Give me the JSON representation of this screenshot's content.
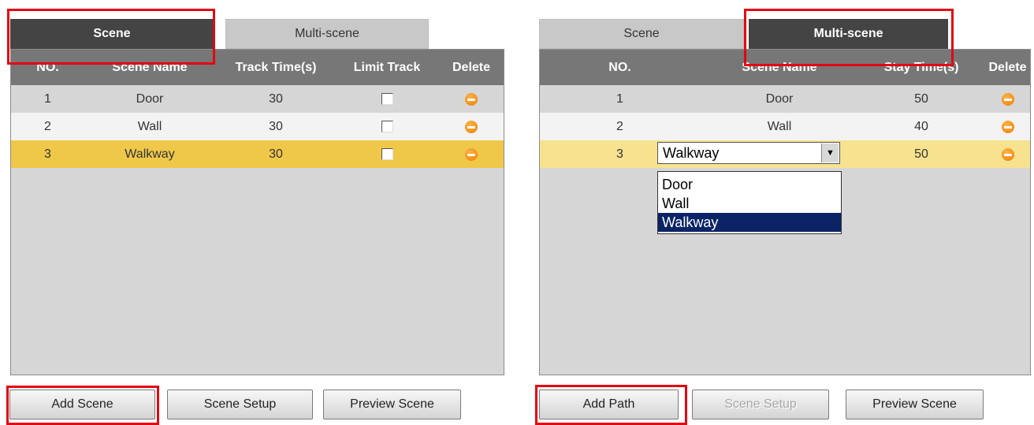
{
  "left": {
    "tabs": [
      {
        "label": "Scene",
        "active": true
      },
      {
        "label": "Multi-scene",
        "active": false
      }
    ],
    "columns": [
      "NO.",
      "Scene Name",
      "Track Time(s)",
      "Limit Track",
      "Delete"
    ],
    "rows": [
      {
        "no": "1",
        "name": "Door",
        "time": "30",
        "limit_checked": false
      },
      {
        "no": "2",
        "name": "Wall",
        "time": "30",
        "limit_checked": false
      },
      {
        "no": "3",
        "name": "Walkway",
        "time": "30",
        "limit_checked": false
      }
    ],
    "buttons": {
      "add": "Add Scene",
      "setup": "Scene Setup",
      "preview": "Preview Scene"
    }
  },
  "right": {
    "tabs": [
      {
        "label": "Scene",
        "active": false
      },
      {
        "label": "Multi-scene",
        "active": true
      }
    ],
    "columns": [
      "NO.",
      "Scene Name",
      "Stay Time(s)",
      "Delete"
    ],
    "rows": [
      {
        "no": "1",
        "name": "Door",
        "time": "50"
      },
      {
        "no": "2",
        "name": "Wall",
        "time": "40"
      },
      {
        "no": "3",
        "name": "Walkway",
        "time": "50"
      }
    ],
    "combo": {
      "value": "Walkway",
      "options": [
        "Door",
        "Wall",
        "Walkway"
      ]
    },
    "buttons": {
      "add": "Add Path",
      "setup": "Scene Setup",
      "preview": "Preview Scene"
    }
  },
  "colors": {
    "highlight": "#e30613",
    "active_tab": "#444444",
    "header": "#777777",
    "selected_row_left": "#efc84a",
    "selected_row_right": "#f7e28f",
    "dropdown_selected": "#0b2466",
    "delete_icon": "#f07c00"
  },
  "icons": [
    "delete-icon",
    "checkbox",
    "dropdown-arrow-icon"
  ]
}
